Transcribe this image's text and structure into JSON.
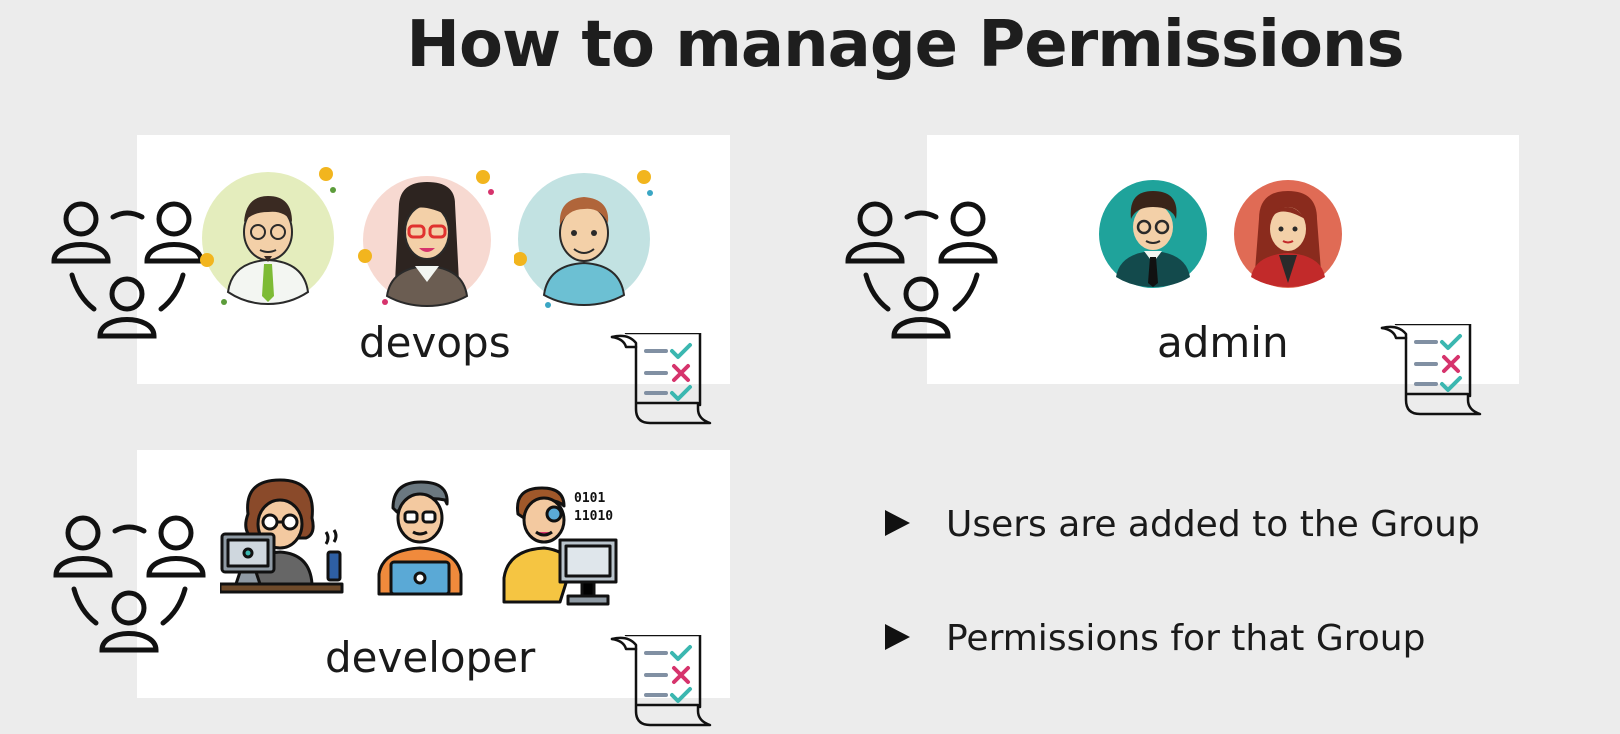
{
  "slide": {
    "title": "How to manage Permissions"
  },
  "groups": [
    {
      "label": "devops",
      "icon": "group-icon",
      "members": [
        "man-glasses-tie-avatar",
        "woman-red-glasses-avatar",
        "man-blue-shirt-avatar"
      ]
    },
    {
      "label": "admin",
      "icon": "group-icon",
      "members": [
        "man-suit-glasses-avatar",
        "woman-red-hair-avatar"
      ]
    },
    {
      "label": "developer",
      "icon": "group-icon",
      "members": [
        "developer-laptop-coffee-icon",
        "developer-laptop-icon",
        "developer-binary-monitor-icon"
      ]
    }
  ],
  "bullets": [
    {
      "text": "Users are added to the Group"
    },
    {
      "text": "Permissions for that Group"
    }
  ],
  "colors": {
    "background": "#ececec",
    "panel": "#ffffff",
    "check": "#3bb7b0",
    "cross": "#d6336c",
    "text": "#1a1a1a"
  }
}
